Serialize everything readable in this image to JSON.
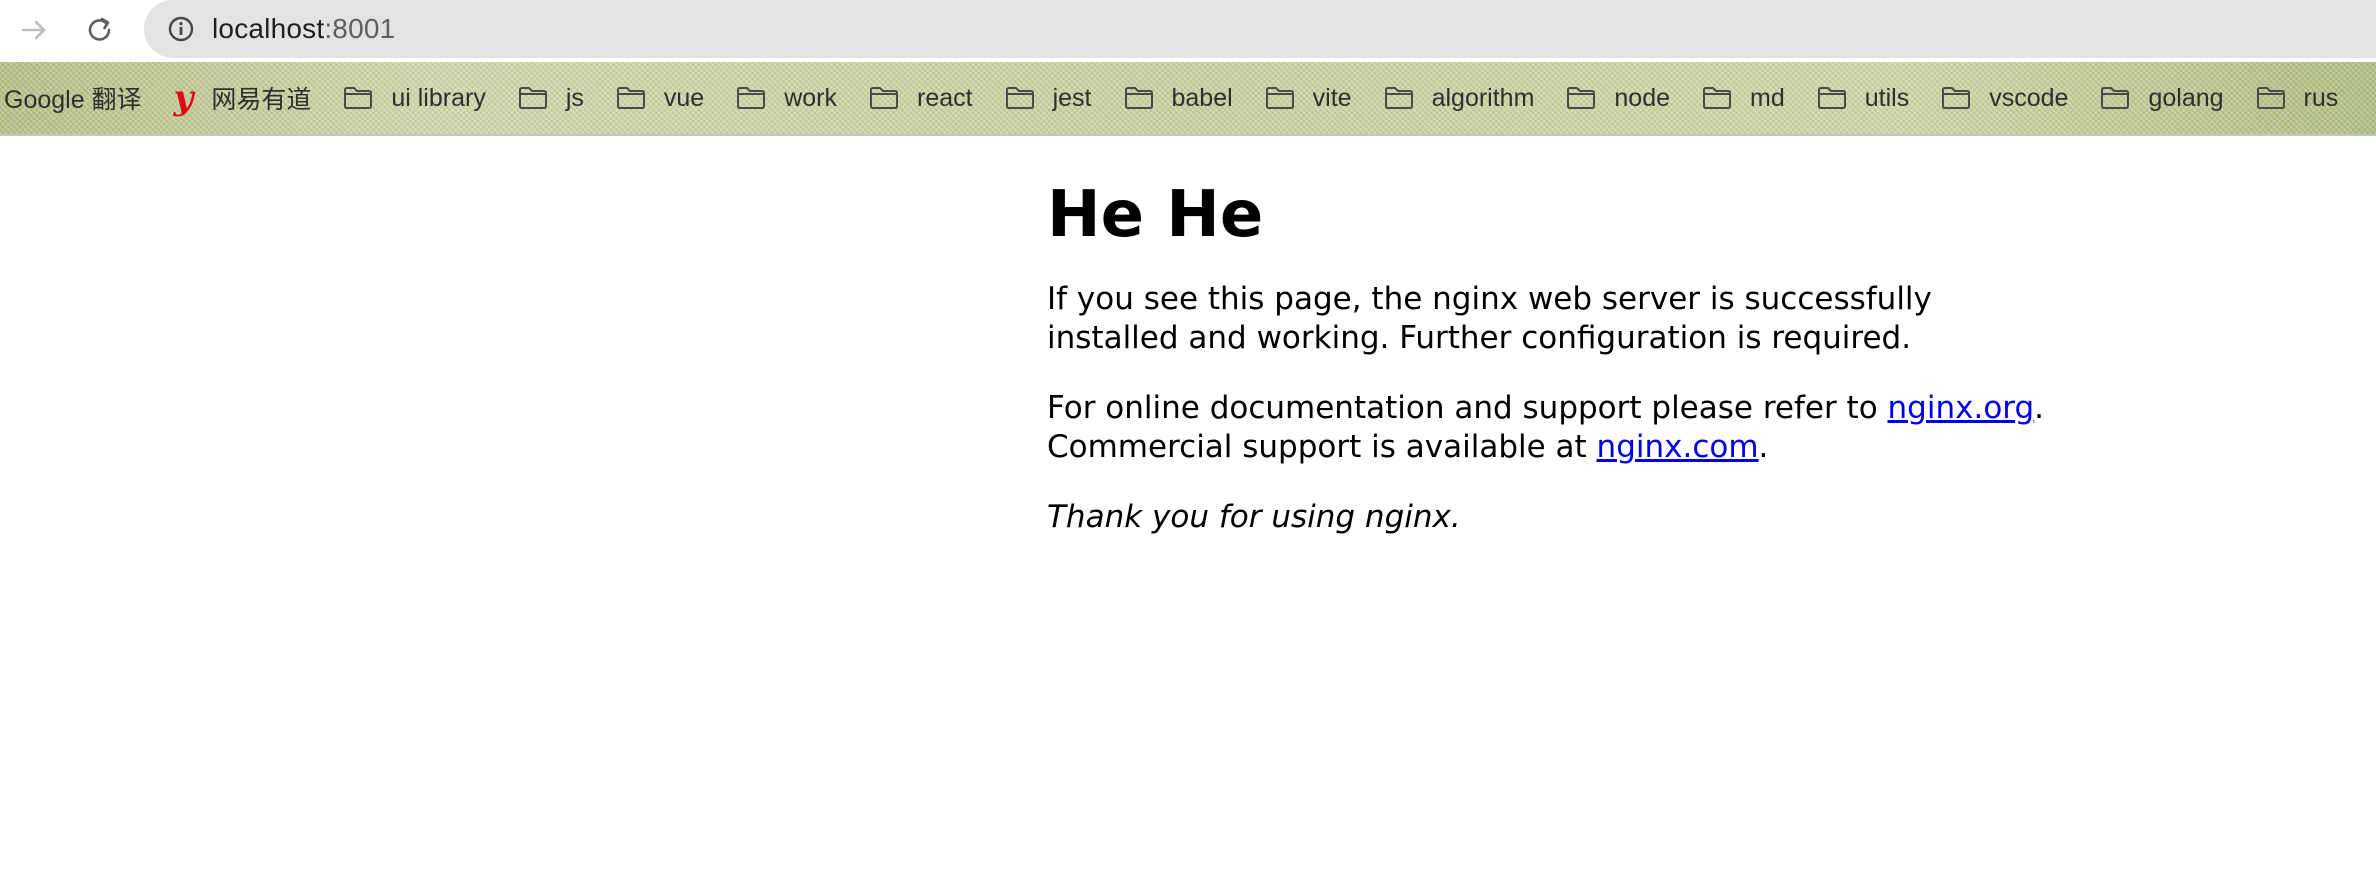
{
  "browser": {
    "url_host": "localhost",
    "url_port": ":8001",
    "icons": {
      "forward": "arrow-right-icon",
      "reload": "reload-icon",
      "site_info": "info-circle-icon"
    }
  },
  "bookmarks": [
    {
      "label": "Google 翻译",
      "icon": "none"
    },
    {
      "label": "网易有道",
      "icon": "youdao-icon",
      "icon_glyph": "y"
    },
    {
      "label": "ui library",
      "icon": "folder-icon"
    },
    {
      "label": "js",
      "icon": "folder-icon"
    },
    {
      "label": "vue",
      "icon": "folder-icon"
    },
    {
      "label": "work",
      "icon": "folder-icon"
    },
    {
      "label": "react",
      "icon": "folder-icon"
    },
    {
      "label": "jest",
      "icon": "folder-icon"
    },
    {
      "label": "babel",
      "icon": "folder-icon"
    },
    {
      "label": "vite",
      "icon": "folder-icon"
    },
    {
      "label": "algorithm",
      "icon": "folder-icon"
    },
    {
      "label": "node",
      "icon": "folder-icon"
    },
    {
      "label": "md",
      "icon": "folder-icon"
    },
    {
      "label": "utils",
      "icon": "folder-icon"
    },
    {
      "label": "vscode",
      "icon": "folder-icon"
    },
    {
      "label": "golang",
      "icon": "folder-icon"
    },
    {
      "label": "rus",
      "icon": "folder-icon"
    }
  ],
  "page": {
    "heading": "He He",
    "p1": "If you see this page, the nginx web server is successfully installed and working. Further configuration is required.",
    "p2_before": "For online documentation and support please refer to ",
    "p2_link1": "nginx.org",
    "p2_middle": ".",
    "p2_line2": "Commercial support is available at ",
    "p2_link2": "nginx.com",
    "p2_end": ".",
    "p3": "Thank you for using nginx."
  },
  "colors": {
    "link": "#0000ee",
    "omnibox_bg": "#e3e3e3",
    "youdao_red": "#e60012"
  }
}
